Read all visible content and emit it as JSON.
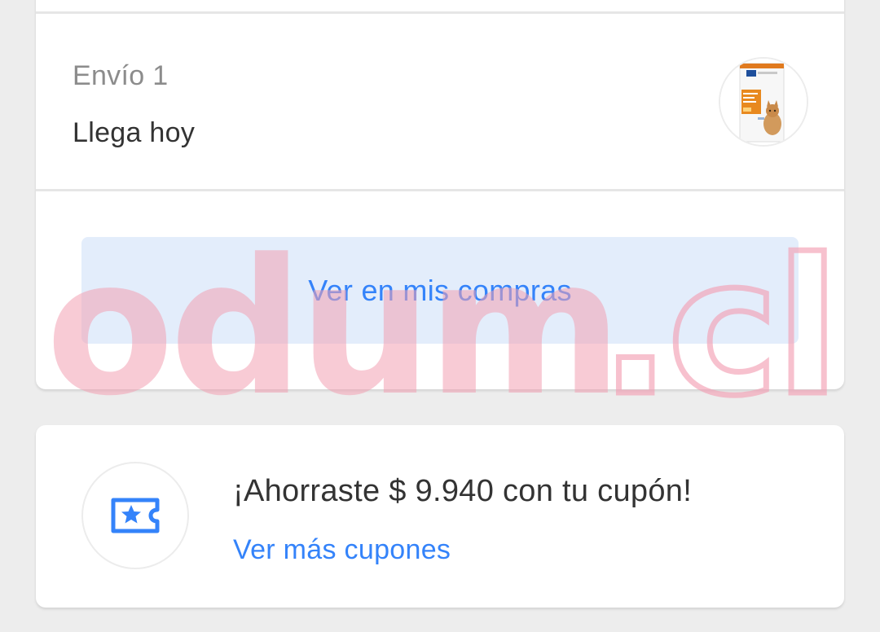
{
  "shipment": {
    "label": "Envío 1",
    "status": "Llega hoy",
    "product_image_icon": "cat-food-bag-icon"
  },
  "actions": {
    "view_purchases_label": "Ver en mis compras"
  },
  "coupon": {
    "icon": "ticket-star-icon",
    "title": "¡Ahorraste $ 9.940 con tu cupón!",
    "link_label": "Ver más cupones"
  },
  "watermark": {
    "text": "odum.cl"
  },
  "colors": {
    "accent_blue": "#3483fa",
    "button_bg": "#e3edfb",
    "page_bg": "#ededed",
    "watermark_pink": "#f2a0b3"
  }
}
